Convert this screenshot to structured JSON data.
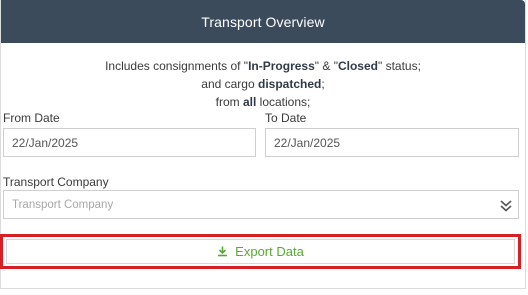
{
  "header": {
    "title": "Transport Overview"
  },
  "info": {
    "line1_prefix": "Includes consignments of \"",
    "line1_status1": "In-Progress",
    "line1_mid": "\" & \"",
    "line1_status2": "Closed",
    "line1_suffix": "\" status;",
    "line2_prefix": "and cargo ",
    "line2_bold": "dispatched",
    "line2_suffix": ";",
    "line3_prefix": "from ",
    "line3_bold": "all",
    "line3_suffix": " locations;"
  },
  "form": {
    "from_date": {
      "label": "From Date",
      "value": "22/Jan/2025"
    },
    "to_date": {
      "label": "To Date",
      "value": "22/Jan/2025"
    },
    "transport_company": {
      "label": "Transport Company",
      "placeholder": "Transport Company"
    }
  },
  "actions": {
    "export_label": "Export Data"
  },
  "colors": {
    "header_bg": "#3c4b5c",
    "export_green": "#5aa832",
    "highlight_red": "#d71f26"
  },
  "icons": {
    "dropdown": "double-chevron-down-icon",
    "export": "download-icon"
  }
}
